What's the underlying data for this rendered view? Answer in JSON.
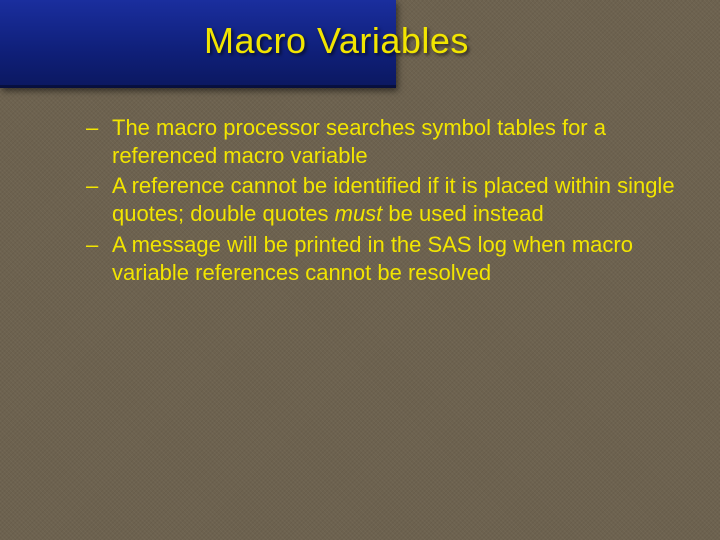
{
  "title": "Macro Variables",
  "bullets": [
    {
      "dash": "–",
      "text": "The macro processor searches symbol tables for a referenced macro variable"
    },
    {
      "dash": "–",
      "pre": "A reference cannot be identified if it is placed within single quotes; double quotes ",
      "em": "must",
      "post": " be used instead"
    },
    {
      "dash": "–",
      "text": "A message will be printed in the SAS log when macro variable references cannot be resolved"
    }
  ]
}
